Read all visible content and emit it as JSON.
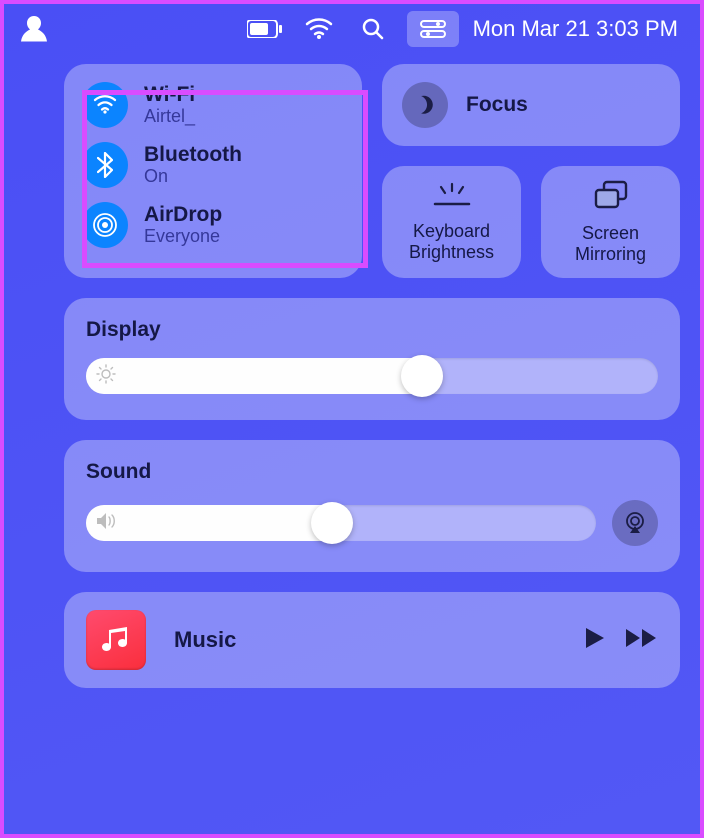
{
  "menubar": {
    "datetime": "Mon Mar 21  3:03 PM"
  },
  "network": {
    "wifi": {
      "label": "Wi-Fi",
      "status": "Airtel_"
    },
    "bluetooth": {
      "label": "Bluetooth",
      "status": "On"
    },
    "airdrop": {
      "label": "AirDrop",
      "status": "Everyone"
    }
  },
  "focus": {
    "label": "Focus"
  },
  "quick": {
    "keyboard": "Keyboard\nBrightness",
    "mirroring": "Screen\nMirroring"
  },
  "display": {
    "label": "Display",
    "value": 62
  },
  "sound": {
    "label": "Sound",
    "value": 52
  },
  "music": {
    "label": "Music"
  },
  "colors": {
    "accent": "#0b84ff",
    "highlight": "#d94cff"
  }
}
